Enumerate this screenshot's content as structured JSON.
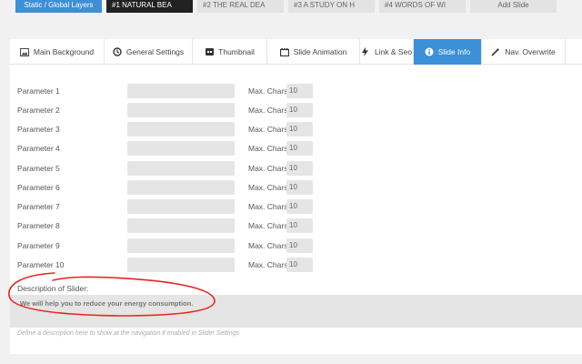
{
  "slide_tabs": {
    "static": "Static / Global Layers",
    "slide1": "#1 NATURAL BEA",
    "slide2": "#2 THE REAL DEA",
    "slide3": "#3 A STUDY ON H",
    "slide4": "#4 WORDS OF WI",
    "add": "Add Slide"
  },
  "settings_tabs": {
    "main_background": "Main Background",
    "general_settings": "General Settings",
    "thumbnail": "Thumbnail",
    "slide_animation": "Slide Animation",
    "link_seo": "Link & Seo",
    "slide_info": "Slide Info",
    "nav_overwrite": "Nav. Overwrite"
  },
  "parameters": [
    {
      "label": "Parameter 1",
      "max_label": "Max. Chars",
      "max": "10"
    },
    {
      "label": "Parameter 2",
      "max_label": "Max. Chars",
      "max": "10"
    },
    {
      "label": "Parameter 3",
      "max_label": "Max. Chars",
      "max": "10"
    },
    {
      "label": "Parameter 4",
      "max_label": "Max. Chars",
      "max": "10"
    },
    {
      "label": "Parameter 5",
      "max_label": "Max. Chars",
      "max": "10"
    },
    {
      "label": "Parameter 6",
      "max_label": "Max. Chars",
      "max": "10"
    },
    {
      "label": "Parameter 7",
      "max_label": "Max. Chars",
      "max": "10"
    },
    {
      "label": "Parameter 8",
      "max_label": "Max. Chars",
      "max": "10"
    },
    {
      "label": "Parameter 9",
      "max_label": "Max. Chars",
      "max": "10"
    },
    {
      "label": "Parameter 10",
      "max_label": "Max. Chars",
      "max": "10"
    }
  ],
  "description": {
    "label": "Description of Slider:",
    "value": "We will help you to reduce your energy consumption.",
    "hint": "Define a description here to show at the navigation if enabled in Slider Settings"
  },
  "colors": {
    "accent": "#3d8fd7",
    "active_slide": "#222222",
    "annotation": "#e8261e"
  },
  "icons": {
    "main_background": "image-icon",
    "general_settings": "history-icon",
    "thumbnail": "thumbnail-icon",
    "slide_animation": "film-icon",
    "link_seo": "bolt-icon",
    "slide_info": "info-icon",
    "nav_overwrite": "magic-wand-icon"
  }
}
